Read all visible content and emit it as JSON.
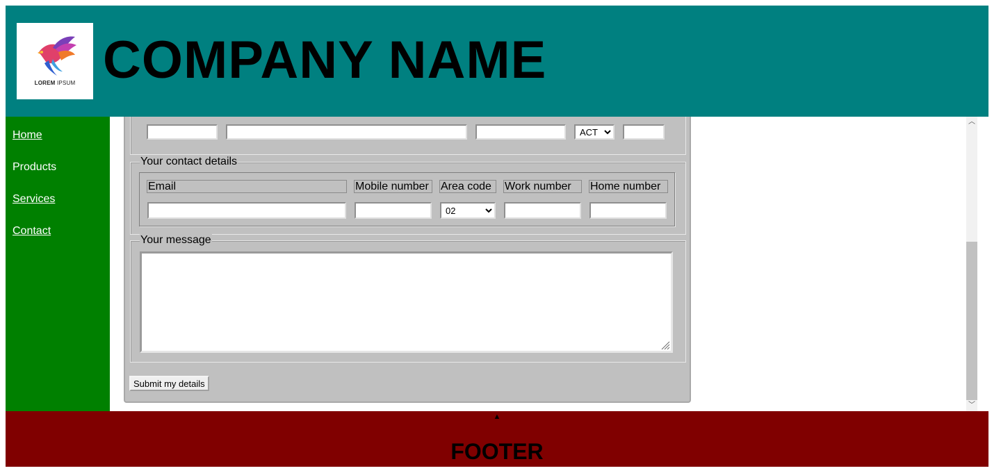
{
  "header": {
    "logo_text_bold": "LOREM",
    "logo_text_light": "IPSUM",
    "title": "COMPANY NAME",
    "bg_color": "#008080"
  },
  "nav": {
    "bg_color": "#008000",
    "items": [
      {
        "label": "Home"
      },
      {
        "label": "Products"
      },
      {
        "label": "Services"
      },
      {
        "label": "Contact"
      }
    ]
  },
  "address_row": {
    "state_value": "ACT",
    "state_options": [
      "ACT"
    ],
    "postcode_value": ""
  },
  "contact": {
    "legend": "Your contact details",
    "columns": [
      "Email",
      "Mobile number",
      "Area code",
      "Work number",
      "Home number"
    ],
    "area_code_value": "02",
    "area_code_options": [
      "02"
    ]
  },
  "message": {
    "legend": "Your message"
  },
  "submit_label": "Submit my details",
  "footer": {
    "arrow": "▲",
    "label": "FOOTER",
    "bg_color": "#800000"
  },
  "scrollbar": {
    "up_arrow": "︿",
    "down_arrow": "﹀"
  }
}
